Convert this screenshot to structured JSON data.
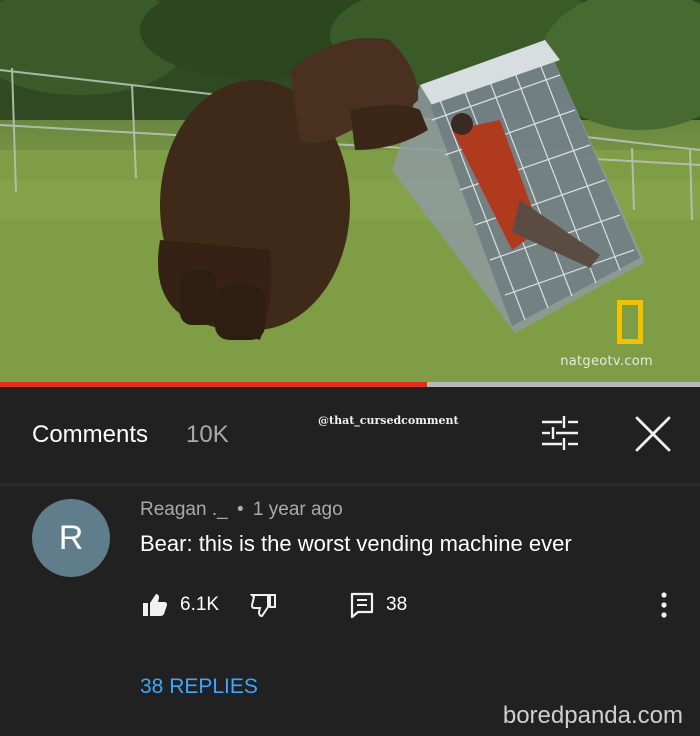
{
  "video": {
    "watermark": "natgeotv.com",
    "progress": 0.61,
    "accent_color": "#e32b1e"
  },
  "header": {
    "title": "Comments",
    "count": "10K",
    "credit": "@that_cursedcomment",
    "filter_icon": "filter-sliders-icon",
    "close_icon": "close-x-icon"
  },
  "comment": {
    "avatar_letter": "R",
    "avatar_color": "#5f7d8b",
    "author": "Reagan ._",
    "separator": "•",
    "time": "1 year ago",
    "text": "Bear: this is the worst vending machine ever",
    "likes": "6.1K",
    "replies_count": "38",
    "like_icon": "thumbs-up-icon",
    "dislike_icon": "thumbs-down-icon",
    "reply_icon": "reply-comment-icon",
    "more_icon": "more-vertical-icon"
  },
  "replies_link": {
    "label": "38 REPLIES",
    "color": "#3ea6ff"
  },
  "footer": {
    "watermark": "boredpanda.com"
  }
}
